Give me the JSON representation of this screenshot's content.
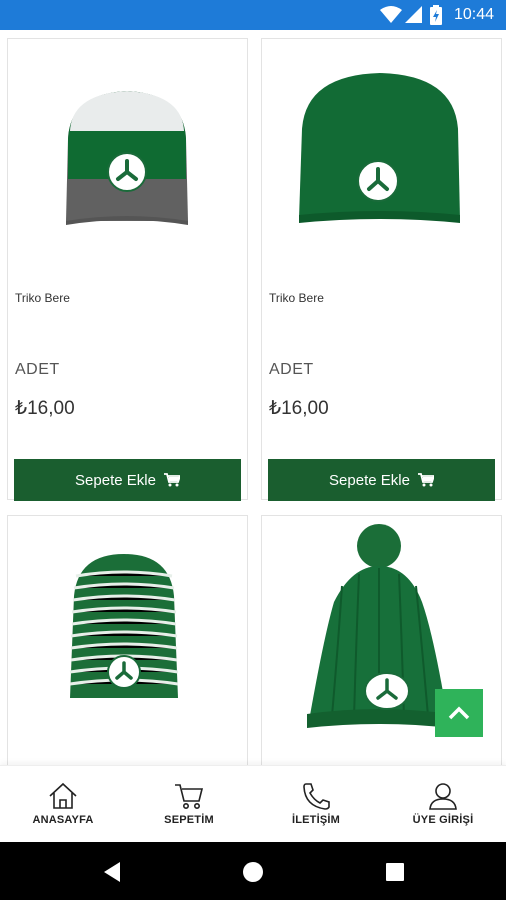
{
  "status_bar": {
    "time": "10:44",
    "icons": [
      "wifi-icon",
      "signal-icon",
      "battery-icon"
    ],
    "color": "#1e7bd8"
  },
  "products": [
    {
      "name": "Triko Bere",
      "unit": "ADET",
      "price": "₺16,00",
      "button_label": "Sepete Ekle",
      "image": "white-green-grey-knit-beanie"
    },
    {
      "name": "Triko Bere",
      "unit": "ADET",
      "price": "₺16,00",
      "button_label": "Sepete Ekle",
      "image": "green-knit-beanie"
    },
    {
      "image": "green-white-striped-beanie"
    },
    {
      "image": "green-cable-knit-pompom-beanie"
    }
  ],
  "bottom_nav": [
    {
      "label": "ANASAYFA",
      "icon": "home-icon"
    },
    {
      "label": "SEPETİM",
      "icon": "cart-icon"
    },
    {
      "label": "İLETİŞİM",
      "icon": "phone-icon"
    },
    {
      "label": "ÜYE GİRİŞİ",
      "icon": "user-icon"
    }
  ],
  "colors": {
    "brand_green": "#1a5e2f",
    "accent_green": "#2fb35a",
    "status_blue": "#1e7bd8"
  }
}
